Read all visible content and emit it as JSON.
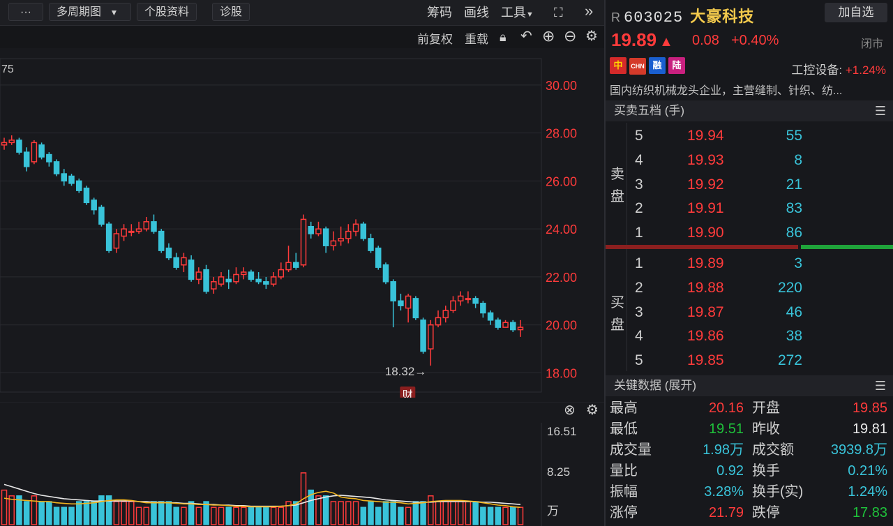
{
  "toolbar": {
    "more": "···",
    "multi_period": "多周期图",
    "stock_info": "个股资料",
    "diagnose": "诊股",
    "chips": "筹码",
    "draw": "画线",
    "tools": "工具",
    "expand_icon": "fullscreen-icon",
    "collapse_icon": "double-chevron-right-icon"
  },
  "subbar": {
    "adjust": "前复权",
    "overlay": "重载",
    "icons": [
      "lock-icon",
      "undo-icon",
      "zoom-in-icon",
      "zoom-out-icon",
      "gear-icon"
    ]
  },
  "chart_data": {
    "type": "candlestick",
    "corner_label": "75",
    "y_ticks": [
      "30.00",
      "28.00",
      "26.00",
      "24.00",
      "22.00",
      "20.00",
      "18.00"
    ],
    "ylim": [
      17.2,
      31.1
    ],
    "min_annotation": "18.32→",
    "finance_marker": "财",
    "candles": [
      [
        27.5,
        27.6,
        27.3,
        27.8
      ],
      [
        27.6,
        27.7,
        27.5,
        27.9
      ],
      [
        27.7,
        27.2,
        27.1,
        27.8
      ],
      [
        27.2,
        26.6,
        26.4,
        27.4
      ],
      [
        26.8,
        27.6,
        26.7,
        27.7
      ],
      [
        27.5,
        27.0,
        26.9,
        27.6
      ],
      [
        27.1,
        26.8,
        26.6,
        27.2
      ],
      [
        26.8,
        26.3,
        26.2,
        26.9
      ],
      [
        26.3,
        26.0,
        25.8,
        26.5
      ],
      [
        26.2,
        25.9,
        25.8,
        26.3
      ],
      [
        26.0,
        25.6,
        25.5,
        26.1
      ],
      [
        25.7,
        25.1,
        25.0,
        25.8
      ],
      [
        25.2,
        24.8,
        24.6,
        25.3
      ],
      [
        24.9,
        24.2,
        24.1,
        25.0
      ],
      [
        24.2,
        23.1,
        23.0,
        24.3
      ],
      [
        23.2,
        23.8,
        23.0,
        24.0
      ],
      [
        23.7,
        24.0,
        23.5,
        24.2
      ],
      [
        23.9,
        23.9,
        23.7,
        24.2
      ],
      [
        23.9,
        24.0,
        23.8,
        24.3
      ],
      [
        24.0,
        24.3,
        23.9,
        24.5
      ],
      [
        24.3,
        23.9,
        23.8,
        24.6
      ],
      [
        23.9,
        23.1,
        23.0,
        24.0
      ],
      [
        23.2,
        22.8,
        22.7,
        23.4
      ],
      [
        22.8,
        22.4,
        22.3,
        23.0
      ],
      [
        22.5,
        22.8,
        22.2,
        23.0
      ],
      [
        22.7,
        21.9,
        21.8,
        22.9
      ],
      [
        21.9,
        22.2,
        21.7,
        22.4
      ],
      [
        22.3,
        21.4,
        21.3,
        22.5
      ],
      [
        21.5,
        21.8,
        21.3,
        22.0
      ],
      [
        21.7,
        22.0,
        21.6,
        22.2
      ],
      [
        21.9,
        21.8,
        21.5,
        22.3
      ],
      [
        21.8,
        22.1,
        21.7,
        22.4
      ],
      [
        22.1,
        22.2,
        21.9,
        22.4
      ],
      [
        22.2,
        21.9,
        21.8,
        22.3
      ],
      [
        21.9,
        21.8,
        21.7,
        22.2
      ],
      [
        21.8,
        21.7,
        21.5,
        22.0
      ],
      [
        21.7,
        22.0,
        21.6,
        22.2
      ],
      [
        22.0,
        22.3,
        21.9,
        22.6
      ],
      [
        22.3,
        22.6,
        22.2,
        23.3
      ],
      [
        22.6,
        22.4,
        22.3,
        23.0
      ],
      [
        22.5,
        24.4,
        22.4,
        24.6
      ],
      [
        24.1,
        23.8,
        23.6,
        24.3
      ],
      [
        23.8,
        24.0,
        23.7,
        24.3
      ],
      [
        24.0,
        23.3,
        23.0,
        24.1
      ],
      [
        23.3,
        23.5,
        23.1,
        23.9
      ],
      [
        23.5,
        23.6,
        23.3,
        24.1
      ],
      [
        23.6,
        23.9,
        23.4,
        24.2
      ],
      [
        23.9,
        24.2,
        23.7,
        24.4
      ],
      [
        24.2,
        23.6,
        23.5,
        24.3
      ],
      [
        23.6,
        23.1,
        23.0,
        23.8
      ],
      [
        23.2,
        22.4,
        22.3,
        23.3
      ],
      [
        22.5,
        21.8,
        21.7,
        22.6
      ],
      [
        21.8,
        21.0,
        19.9,
        21.9
      ],
      [
        21.0,
        20.8,
        20.6,
        21.3
      ],
      [
        20.7,
        21.2,
        20.1,
        21.3
      ],
      [
        21.1,
        20.3,
        20.2,
        21.2
      ],
      [
        20.2,
        18.9,
        18.8,
        20.3
      ],
      [
        19.0,
        20.0,
        18.3,
        20.2
      ],
      [
        20.0,
        20.3,
        19.9,
        20.6
      ],
      [
        20.3,
        20.6,
        20.1,
        20.8
      ],
      [
        20.6,
        21.0,
        20.5,
        21.2
      ],
      [
        21.0,
        21.2,
        20.8,
        21.4
      ],
      [
        21.1,
        21.1,
        20.9,
        21.4
      ],
      [
        21.1,
        20.9,
        20.7,
        21.2
      ],
      [
        20.9,
        20.5,
        20.3,
        21.0
      ],
      [
        20.5,
        20.2,
        20.0,
        20.6
      ],
      [
        20.2,
        19.9,
        19.8,
        20.3
      ],
      [
        19.9,
        20.1,
        19.9,
        20.2
      ],
      [
        20.1,
        19.8,
        19.7,
        20.2
      ],
      [
        19.8,
        19.9,
        19.5,
        20.2
      ]
    ],
    "vol_ticks": [
      "16.51",
      "8.25",
      "万"
    ],
    "vol_max": 16.51,
    "volumes": [
      6,
      5,
      5,
      4,
      5,
      4,
      4,
      3,
      3,
      3,
      4,
      4,
      4,
      5,
      5,
      4,
      4,
      4,
      3,
      3,
      4,
      4,
      4,
      3,
      3,
      4,
      3,
      4,
      3,
      3,
      3,
      3,
      3,
      3,
      3,
      3,
      3,
      3,
      4,
      4,
      9,
      6,
      5,
      5,
      4,
      4,
      4,
      4,
      3,
      4,
      3,
      4,
      4,
      3,
      3,
      4,
      4,
      5,
      4,
      4,
      4,
      4,
      4,
      4,
      3,
      3,
      3,
      3,
      3,
      3
    ],
    "ma5": [
      4.6,
      4.4,
      4.3,
      4.2,
      4.1,
      4.0,
      4.0,
      3.8,
      3.7,
      3.6,
      3.6,
      3.7,
      3.8,
      4.0,
      4.2,
      4.3,
      4.3,
      4.2,
      4.0,
      3.8,
      3.8,
      3.8,
      3.8,
      3.7,
      3.6,
      3.6,
      3.5,
      3.5,
      3.4,
      3.4,
      3.3,
      3.2,
      3.2,
      3.1,
      3.1,
      3.1,
      3.1,
      3.2,
      3.3,
      3.6,
      4.5,
      5.2,
      5.6,
      5.8,
      5.5,
      4.8,
      4.6,
      4.5,
      4.2,
      4.1,
      4.0,
      3.9,
      3.9,
      3.8,
      3.6,
      3.7,
      3.8,
      4.0,
      4.1,
      4.2,
      4.2,
      4.2,
      4.1,
      4.0,
      3.8,
      3.6,
      3.4,
      3.3,
      3.1,
      3.0
    ],
    "ma10": [
      7.0,
      6.6,
      6.2,
      5.8,
      5.4,
      5.1,
      4.9,
      4.7,
      4.5,
      4.4,
      4.3,
      4.2,
      4.1,
      4.1,
      4.1,
      4.1,
      4.1,
      4.1,
      4.0,
      4.0,
      3.9,
      3.9,
      3.8,
      3.8,
      3.7,
      3.7,
      3.6,
      3.5,
      3.5,
      3.4,
      3.4,
      3.3,
      3.3,
      3.2,
      3.2,
      3.2,
      3.2,
      3.2,
      3.3,
      3.4,
      3.8,
      4.2,
      4.5,
      4.8,
      5.0,
      5.1,
      5.0,
      4.9,
      4.8,
      4.7,
      4.5,
      4.3,
      4.2,
      4.1,
      4.0,
      3.9,
      3.9,
      3.9,
      4.0,
      4.0,
      4.0,
      4.0,
      4.0,
      4.0,
      3.9,
      3.9,
      3.8,
      3.7,
      3.6,
      3.5
    ]
  },
  "quote": {
    "r_flag": "R",
    "code": "603025",
    "name": "大豪科技",
    "add_watch": "加自选",
    "price": "19.89",
    "arrow": "▲",
    "change": "0.08",
    "change_pct": "+0.40%",
    "status": "闭市",
    "badges": [
      "中",
      "CHN",
      "融",
      "陆"
    ],
    "sector_label": "工控设备:",
    "sector_pct": "+1.24%",
    "description": "国内纺织机械龙头企业，主营缝制、针织、纺..."
  },
  "orderbook": {
    "title": "买卖五档 (手)",
    "sell_label": [
      "卖",
      "盘"
    ],
    "buy_label": [
      "买",
      "盘"
    ],
    "asks": [
      {
        "level": "5",
        "price": "19.94",
        "vol": "55"
      },
      {
        "level": "4",
        "price": "19.93",
        "vol": "8"
      },
      {
        "level": "3",
        "price": "19.92",
        "vol": "21"
      },
      {
        "level": "2",
        "price": "19.91",
        "vol": "83"
      },
      {
        "level": "1",
        "price": "19.90",
        "vol": "86"
      }
    ],
    "bids": [
      {
        "level": "1",
        "price": "19.89",
        "vol": "3"
      },
      {
        "level": "2",
        "price": "19.88",
        "vol": "220"
      },
      {
        "level": "3",
        "price": "19.87",
        "vol": "46"
      },
      {
        "level": "4",
        "price": "19.86",
        "vol": "38"
      },
      {
        "level": "5",
        "price": "19.85",
        "vol": "272"
      }
    ],
    "ratio_sell": 0.67
  },
  "keydata": {
    "title": "关键数据 (展开)",
    "rows": [
      {
        "l1": "最高",
        "v1": "20.16",
        "c1": "red",
        "l2": "开盘",
        "v2": "19.85",
        "c2": "red"
      },
      {
        "l1": "最低",
        "v1": "19.51",
        "c1": "green",
        "l2": "昨收",
        "v2": "19.81",
        "c2": "white"
      },
      {
        "l1": "成交量",
        "v1": "1.98万",
        "c1": "cyan",
        "l2": "成交额",
        "v2": "3939.8万",
        "c2": "cyan"
      },
      {
        "l1": "量比",
        "v1": "0.92",
        "c1": "cyan",
        "l2": "换手",
        "v2": "0.21%",
        "c2": "cyan"
      },
      {
        "l1": "振幅",
        "v1": "3.28%",
        "c1": "cyan",
        "l2": "换手(实)",
        "v2": "1.24%",
        "c2": "cyan"
      },
      {
        "l1": "涨停",
        "v1": "21.79",
        "c1": "red",
        "l2": "跌停",
        "v2": "17.83",
        "c2": "green"
      }
    ]
  }
}
